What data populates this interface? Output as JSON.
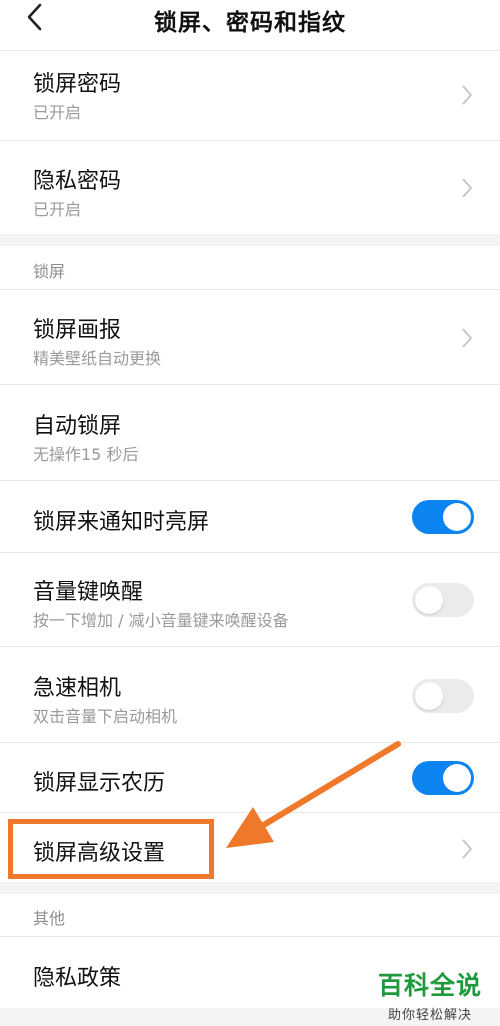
{
  "header": {
    "title": "锁屏、密码和指纹"
  },
  "rows": {
    "lock_password": {
      "label": "锁屏密码",
      "sub": "已开启"
    },
    "privacy_password": {
      "label": "隐私密码",
      "sub": "已开启"
    },
    "lock_wallpaper": {
      "label": "锁屏画报",
      "sub": "精美壁纸自动更换"
    },
    "auto_lock": {
      "label": "自动锁屏",
      "sub": "无操作15 秒后"
    },
    "notify_wake": {
      "label": "锁屏来通知时亮屏",
      "toggle": true
    },
    "volume_wake": {
      "label": "音量键唤醒",
      "sub": "按一下增加 / 减小音量键来唤醒设备",
      "toggle": false
    },
    "quick_camera": {
      "label": "急速相机",
      "sub": "双击音量下启动相机",
      "toggle": false
    },
    "lunar": {
      "label": "锁屏显示农历",
      "toggle": true
    },
    "advanced": {
      "label": "锁屏高级设置"
    },
    "privacy_policy": {
      "label": "隐私政策"
    }
  },
  "sections": {
    "lock": "锁屏",
    "other": "其他"
  },
  "watermark": {
    "title": "百科全说",
    "sub": "助你轻松解决"
  },
  "colors": {
    "toggle_on": "#0b84f2",
    "highlight": "#f0782a",
    "watermark": "#1e9a3c"
  }
}
